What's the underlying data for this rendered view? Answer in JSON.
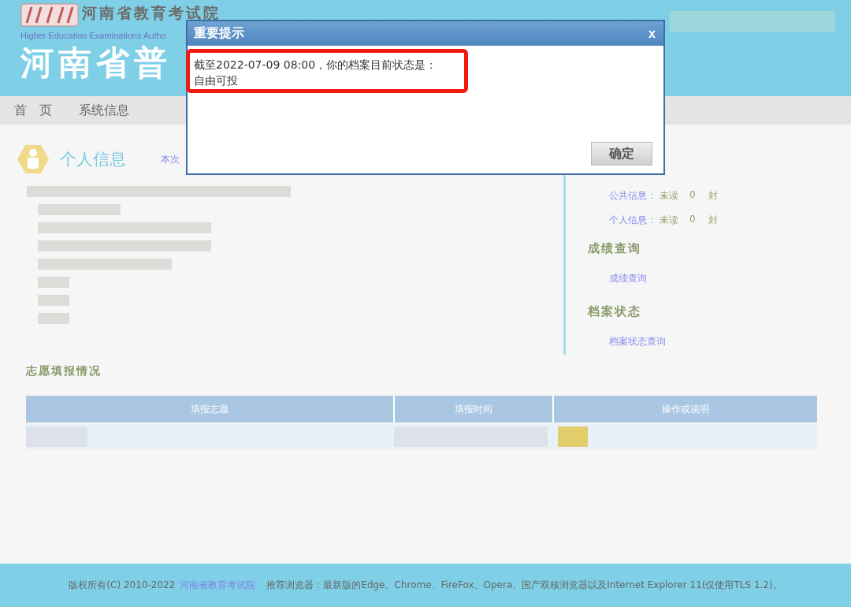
{
  "header": {
    "org_name": "河南省教育考试院",
    "org_name_en": "Higher Education Examinations Autho",
    "site_title": "河南省普"
  },
  "nav": [
    {
      "label": "首　页",
      "selected": false
    },
    {
      "label": "系统信息",
      "selected": false
    }
  ],
  "profile": {
    "title": "个人信息",
    "note": "本次"
  },
  "side_panel": {
    "messages": [
      {
        "label": "公共信息：",
        "status": "未读",
        "count": "0",
        "unit": "封"
      },
      {
        "label": "个人信息：",
        "status": "未读",
        "count": "0",
        "unit": "封"
      }
    ],
    "sections": [
      {
        "heading": "成绩查询",
        "links": [
          "成绩查询"
        ]
      },
      {
        "heading": "档案状态",
        "links": [
          "档案状态查询"
        ]
      }
    ]
  },
  "applications": {
    "title": "志愿填报情况",
    "columns": [
      "填报志愿",
      "填报时间",
      "操作或说明"
    ]
  },
  "dialog": {
    "title": "重要提示",
    "close": "x",
    "lines": [
      "截至2022-07-09 08:00，你的档案目前状态是：",
      "自由可投"
    ],
    "highlighted": true,
    "button": "确定"
  },
  "footer": {
    "copyright": "版权所有(C) 2010-2022",
    "org_link": "河南省教育考试院",
    "browsers": "推荐浏览器：最新版的Edge、Chrome、FireFox、Opera、国产双核浏览器以及Internet Explorer 11(仅使用TLS 1.2)。"
  }
}
